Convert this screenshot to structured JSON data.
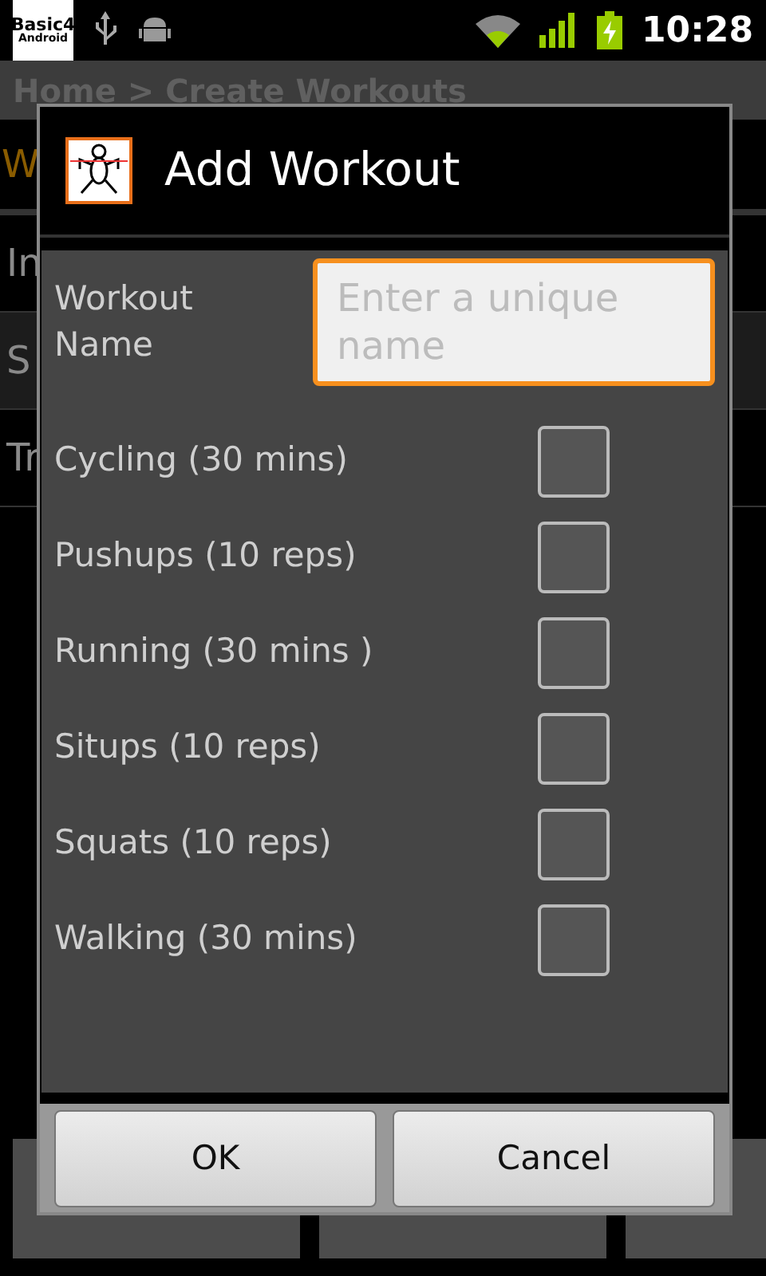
{
  "status_bar": {
    "app_logo": {
      "line_1": "Basic4",
      "line_2": "Android"
    },
    "time": "10:28"
  },
  "background": {
    "breadcrumb": "Home > Create Workouts",
    "heading": "W",
    "items": [
      "In",
      "S",
      "Tr"
    ]
  },
  "dialog": {
    "title": "Add Workout",
    "name_field": {
      "label": "Workout Name",
      "placeholder": "Enter a unique name"
    },
    "options": [
      {
        "label": "Cycling (30 mins)",
        "checked": false
      },
      {
        "label": "Pushups (10 reps)",
        "checked": false
      },
      {
        "label": "Running (30 mins )",
        "checked": false
      },
      {
        "label": "Situps (10 reps)",
        "checked": false
      },
      {
        "label": "Squats (10 reps)",
        "checked": false
      },
      {
        "label": "Walking (30 mins)",
        "checked": false
      }
    ],
    "buttons": [
      "OK",
      "Cancel"
    ]
  }
}
